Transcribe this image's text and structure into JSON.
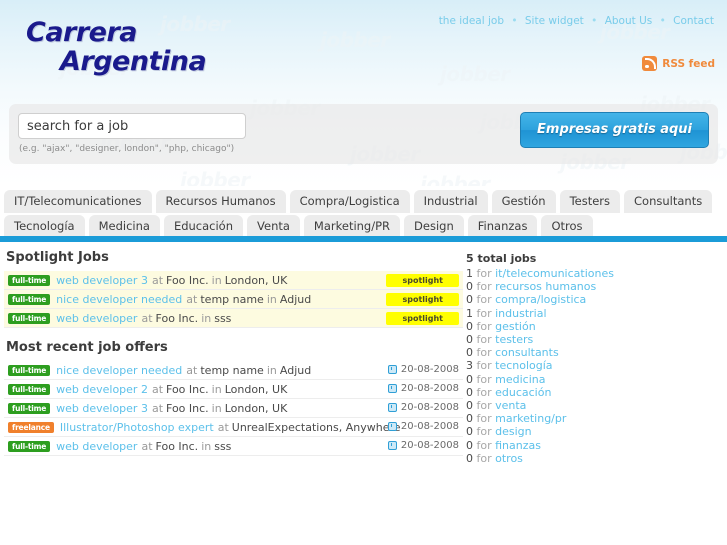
{
  "site": {
    "logo_line1": "Carrera",
    "logo_line2": "Argentina",
    "watermark_text": "jobber"
  },
  "topnav": {
    "items": [
      {
        "label": "the ideal job"
      },
      {
        "label": "Site widget"
      },
      {
        "label": "About Us"
      },
      {
        "label": "Contact"
      }
    ],
    "separator": "•"
  },
  "rss": {
    "label": "RSS feed",
    "icon": "rss-icon",
    "color": "#f08a3c"
  },
  "search": {
    "value": "search for a job",
    "placeholder": "search for a job",
    "hint": "(e.g. \"ajax\", \"designer, london\", \"php, chicago\")",
    "button_label": "Empresas gratis aqui"
  },
  "tabs": {
    "row1": [
      {
        "label": "IT/Telecomunicationes"
      },
      {
        "label": "Recursos Humanos"
      },
      {
        "label": "Compra/Logistica"
      },
      {
        "label": "Industrial"
      },
      {
        "label": "Gestión"
      },
      {
        "label": "Testers"
      },
      {
        "label": "Consultants"
      }
    ],
    "row2": [
      {
        "label": "Tecnología"
      },
      {
        "label": "Medicina"
      },
      {
        "label": "Educación"
      },
      {
        "label": "Venta"
      },
      {
        "label": "Marketing/PR"
      },
      {
        "label": "Design"
      },
      {
        "label": "Finanzas"
      },
      {
        "label": "Otros"
      }
    ],
    "accent_color": "#1b9cd8"
  },
  "spotlight": {
    "title": "Spotlight Jobs",
    "badge_label": "spotlight",
    "jobs": [
      {
        "type": "full-time",
        "title": "web developer 3",
        "at": "at",
        "company": "Foo Inc.",
        "in": "in",
        "location": "London, UK",
        "badge": "spotlight"
      },
      {
        "type": "full-time",
        "title": "nice developer needed",
        "at": "at",
        "company": "temp name",
        "in": "in",
        "location": "Adjud",
        "badge": "spotlight"
      },
      {
        "type": "full-time",
        "title": "web developer",
        "at": "at",
        "company": "Foo Inc.",
        "in": "in",
        "location": "sss",
        "badge": "spotlight"
      }
    ]
  },
  "recent": {
    "title": "Most recent job offers",
    "jobs": [
      {
        "type": "full-time",
        "title": "nice developer needed",
        "at": "at",
        "company": "temp name",
        "in": "in",
        "location": "Adjud",
        "date": "20-08-2008"
      },
      {
        "type": "full-time",
        "title": "web developer 2",
        "at": "at",
        "company": "Foo Inc.",
        "in": "in",
        "location": "London, UK",
        "date": "20-08-2008"
      },
      {
        "type": "full-time",
        "title": "web developer 3",
        "at": "at",
        "company": "Foo Inc.",
        "in": "in",
        "location": "London, UK",
        "date": "20-08-2008"
      },
      {
        "type": "freelance",
        "title": "Illustrator/Photoshop expert",
        "at": "at",
        "company": "UnrealExpectations, Anywhere",
        "in": "",
        "location": "",
        "date": "20-08-2008"
      },
      {
        "type": "full-time",
        "title": "web developer",
        "at": "at",
        "company": "Foo Inc.",
        "in": "in",
        "location": "sss",
        "date": "20-08-2008"
      }
    ]
  },
  "sidebar": {
    "total_count": "5",
    "total_label": "total jobs",
    "for_word": "for",
    "categories": [
      {
        "count": "1",
        "label": "it/telecomunicationes"
      },
      {
        "count": "0",
        "label": "recursos humanos"
      },
      {
        "count": "0",
        "label": "compra/logistica"
      },
      {
        "count": "1",
        "label": "industrial"
      },
      {
        "count": "0",
        "label": "gestión"
      },
      {
        "count": "0",
        "label": "testers"
      },
      {
        "count": "0",
        "label": "consultants"
      },
      {
        "count": "3",
        "label": "tecnología"
      },
      {
        "count": "0",
        "label": "medicina"
      },
      {
        "count": "0",
        "label": "educación"
      },
      {
        "count": "0",
        "label": "venta"
      },
      {
        "count": "0",
        "label": "marketing/pr"
      },
      {
        "count": "0",
        "label": "design"
      },
      {
        "count": "0",
        "label": "finanzas"
      },
      {
        "count": "0",
        "label": "otros"
      }
    ]
  }
}
